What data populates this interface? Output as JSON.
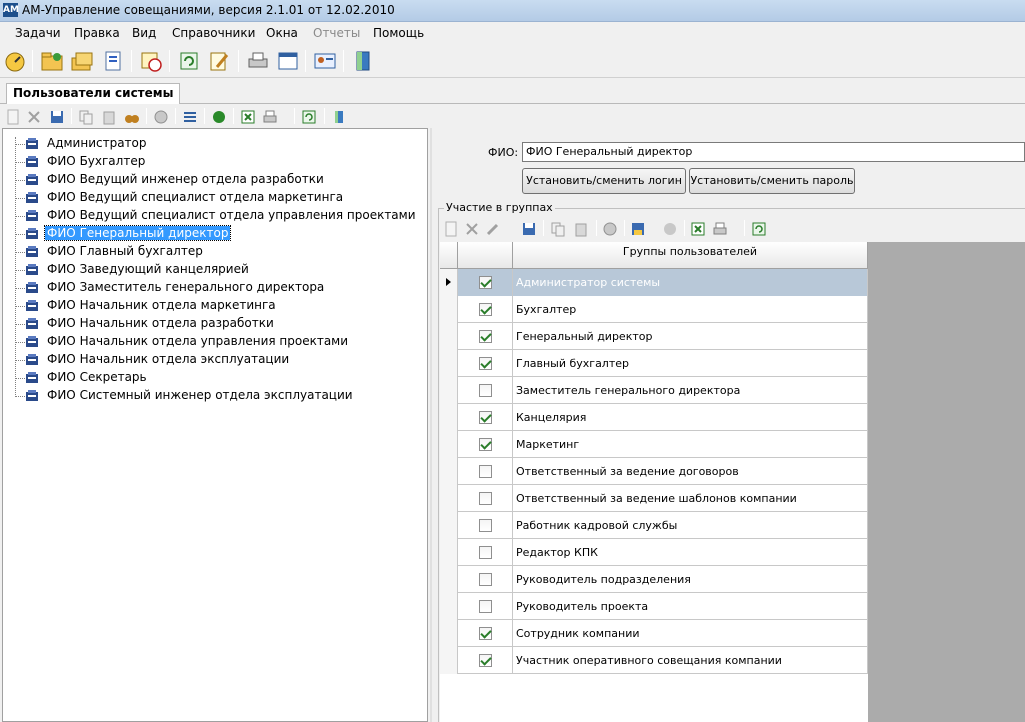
{
  "window": {
    "title": "АМ-Управление совещаниями, версия 2.1.01 от 12.02.2010",
    "app_icon_text": "AM"
  },
  "menu": {
    "items": [
      {
        "label": "Задачи",
        "enabled": true
      },
      {
        "label": "Правка",
        "enabled": true
      },
      {
        "label": "Вид",
        "enabled": true
      },
      {
        "label": "Справочники",
        "enabled": true
      },
      {
        "label": "Окна",
        "enabled": true
      },
      {
        "label": "Отчеты",
        "enabled": false
      },
      {
        "label": "Помощь",
        "enabled": true
      }
    ]
  },
  "main_toolbar": {
    "icons": [
      "dashboard-icon",
      "add-folder-icon",
      "folders-icon",
      "document-icon",
      "calendar-clock-icon",
      "refresh-document-icon",
      "edit-document-icon",
      "printer-icon",
      "window-icon",
      "contact-card-icon",
      "exit-door-icon"
    ]
  },
  "tab": {
    "label": "Пользователи системы"
  },
  "left_toolbar": {
    "icons": [
      "new-icon",
      "delete-icon",
      "save-icon",
      "copy-icon",
      "paste-icon",
      "binoculars-icon",
      "undo-icon",
      "list-icon",
      "refresh-green-icon",
      "excel-icon",
      "print-icon",
      "reload-icon",
      "exit-icon"
    ]
  },
  "users": {
    "selected_index": 5,
    "items": [
      "Администратор",
      "ФИО Бухгалтер",
      "ФИО Ведущий инженер отдела разработки",
      "ФИО Ведущий специалист отдела маркетинга",
      "ФИО Ведущий специалист отдела управления проектами",
      "ФИО Генеральный директор",
      "ФИО Главный бухгалтер",
      "ФИО Заведующий канцелярией",
      "ФИО Заместитель генерального директора",
      "ФИО Начальник отдела маркетинга",
      "ФИО Начальник отдела разработки",
      "ФИО Начальник отдела управления проектами",
      "ФИО Начальник отдела эксплуатации",
      "ФИО Секретарь",
      "ФИО Системный инженер отдела эксплуатации"
    ]
  },
  "form": {
    "fio_label": "ФИО:",
    "fio_value": "ФИО Генеральный директор",
    "login_button": "Установить/сменить логин",
    "password_button": "Установить/сменить пароль",
    "groups_title": "Участие в группах"
  },
  "grid": {
    "column_header": "Группы пользователей",
    "selected_index": 0,
    "rows": [
      {
        "name": "Администратор системы",
        "checked": true
      },
      {
        "name": "Бухгалтер",
        "checked": true
      },
      {
        "name": "Генеральный директор",
        "checked": true
      },
      {
        "name": "Главный бухгалтер",
        "checked": true
      },
      {
        "name": "Заместитель генерального директора",
        "checked": false
      },
      {
        "name": "Канцелярия",
        "checked": true
      },
      {
        "name": "Маркетинг",
        "checked": true
      },
      {
        "name": "Ответственный за ведение договоров",
        "checked": false
      },
      {
        "name": "Ответственный за ведение шаблонов компании",
        "checked": false
      },
      {
        "name": "Работник кадровой службы",
        "checked": false
      },
      {
        "name": "Редактор КПК",
        "checked": false
      },
      {
        "name": "Руководитель подразделения",
        "checked": false
      },
      {
        "name": "Руководитель проекта",
        "checked": false
      },
      {
        "name": "Сотрудник компании",
        "checked": true
      },
      {
        "name": "Участник оперативного совещания компании",
        "checked": true
      }
    ]
  },
  "colors": {
    "selection": "#3399ff",
    "grid_selected_row": "#b8c8d8",
    "checkmark": "#2a7d2a"
  }
}
